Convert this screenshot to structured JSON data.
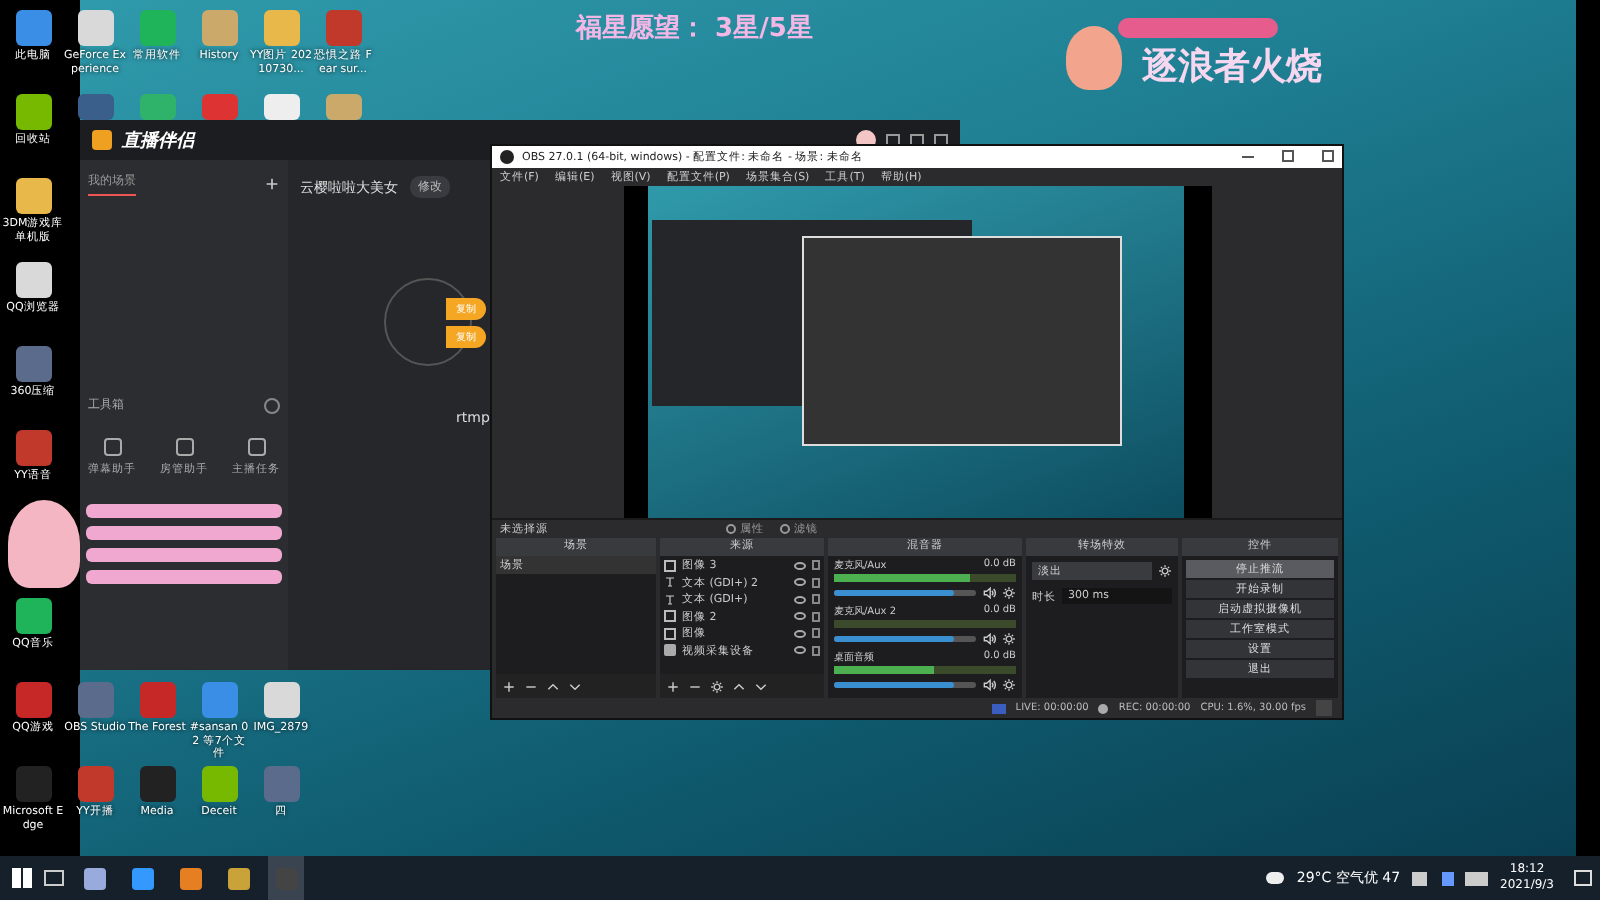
{
  "desktop": {
    "columns": [
      [
        {
          "label": "此电脑"
        },
        {
          "label": "回收站"
        },
        {
          "label": "3DM游戏库单机版"
        },
        {
          "label": "QQ浏览器"
        },
        {
          "label": "360压缩"
        },
        {
          "label": "YY语音"
        },
        {
          "label": "QQ音乐"
        },
        {
          "label": "QQ游戏"
        },
        {
          "label": "Microsoft Edge"
        }
      ],
      [
        {
          "label": "GeForce Experience"
        },
        {
          "label": "OBS Studio"
        },
        {
          "label": "YY开播"
        }
      ],
      [
        {
          "label": "常用软件"
        },
        {
          "label": "The Forest"
        },
        {
          "label": "Media"
        }
      ],
      [
        {
          "label": "History"
        },
        {
          "label": "#sansan 02 等7个文件"
        },
        {
          "label": "Deceit"
        }
      ],
      [
        {
          "label": "YY图片 20210730..."
        },
        {
          "label": "IMG_2879"
        },
        {
          "label": "四"
        }
      ],
      [
        {
          "label": "恐惧之路 Fear sur..."
        }
      ]
    ]
  },
  "overlay": {
    "wish": "福星愿望：  3星/5星",
    "streamer": "逐浪者火烧"
  },
  "companion": {
    "title": "直播伴侣",
    "tabs": [
      {
        "label": "我的场景",
        "selected": true
      }
    ],
    "toolbox": "工具箱",
    "tools": [
      "弹幕助手",
      "房管助手",
      "主播任务"
    ],
    "room": "云樱啦啦大美女",
    "edit": "修改",
    "copy_buttons": [
      "复制",
      "复制"
    ],
    "rtmp": "rtmp"
  },
  "obs": {
    "title": "OBS 27.0.1 (64-bit, windows) - 配置文件: 未命名 - 场景: 未命名",
    "menu": [
      "文件(F)",
      "编辑(E)",
      "视图(V)",
      "配置文件(P)",
      "场景集合(S)",
      "工具(T)",
      "帮助(H)"
    ],
    "no_source": "未选择源",
    "properties": "属性",
    "filters": "滤镜",
    "scenes": {
      "title": "场景",
      "items": [
        {
          "label": "场景",
          "selected": true
        }
      ]
    },
    "sources": {
      "title": "来源",
      "items": [
        {
          "label": "图像 3",
          "kind": "image"
        },
        {
          "label": "文本 (GDI+) 2",
          "kind": "text"
        },
        {
          "label": "文本 (GDI+)",
          "kind": "text"
        },
        {
          "label": "图像 2",
          "kind": "image"
        },
        {
          "label": "图像",
          "kind": "image"
        },
        {
          "label": "视频采集设备",
          "kind": "camera"
        }
      ]
    },
    "mixer": {
      "title": "混音器",
      "channels": [
        {
          "name": "麦克风/Aux",
          "reading": "0.0 dB",
          "meter": {
            "level": 0.75
          },
          "volume": {
            "level": 0.85
          }
        },
        {
          "name": "麦克风/Aux 2",
          "reading": "0.0 dB",
          "meter": {
            "level": 0.0
          },
          "volume": {
            "level": 0.85
          }
        },
        {
          "name": "桌面音频",
          "reading": "0.0 dB",
          "meter": {
            "level": 0.55
          },
          "volume": {
            "level": 0.85
          }
        }
      ]
    },
    "transitions": {
      "title": "转场特效",
      "selected": "淡出",
      "duration_label": "时长",
      "duration": "300 ms"
    },
    "controls": {
      "title": "控件",
      "buttons": [
        {
          "label": "停止推流",
          "selected": true
        },
        {
          "label": "开始录制",
          "selected": false
        },
        {
          "label": "启动虚拟摄像机",
          "selected": false
        },
        {
          "label": "工作室模式",
          "selected": false
        },
        {
          "label": "设置",
          "selected": false
        },
        {
          "label": "退出",
          "selected": false
        }
      ]
    },
    "status": {
      "live": "LIVE: 00:00:00",
      "rec": "REC: 00:00:00",
      "cpu": "CPU: 1.6%, 30.00 fps"
    }
  },
  "taskbar": {
    "weather": "29°C 空气优 47",
    "time": "18:12",
    "date": "2021/9/3"
  }
}
